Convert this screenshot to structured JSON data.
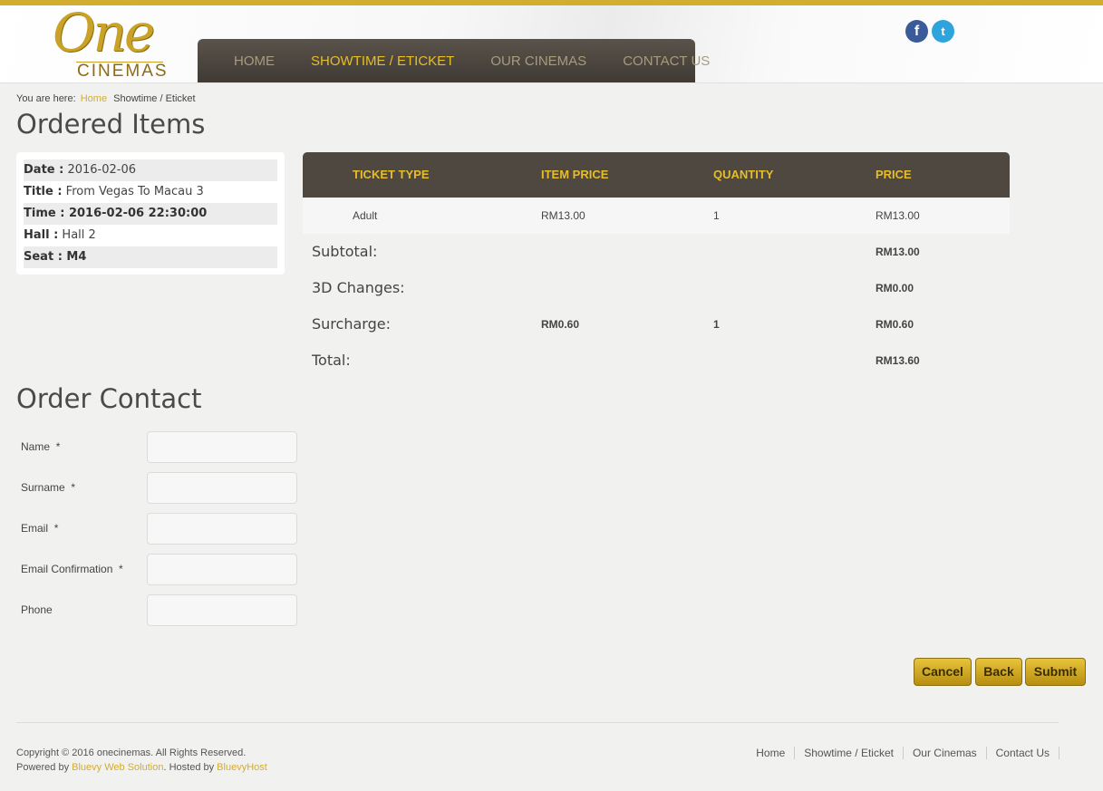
{
  "brand": {
    "logo_main": "One",
    "logo_sub": "CINEMAS",
    "accent": "#d3ad2f"
  },
  "nav": {
    "items": [
      "HOME",
      "SHOWTIME / ETICKET",
      "OUR CINEMAS",
      "CONTACT US"
    ],
    "active": "SHOWTIME / ETICKET"
  },
  "social": {
    "facebook": "f",
    "twitter": "t"
  },
  "breadcrumb": {
    "prefix": "You are here:",
    "home": "Home",
    "current": "Showtime / Eticket"
  },
  "ordered": {
    "title": "Ordered Items",
    "info": [
      {
        "label": "Date :",
        "value": " 2016-02-06",
        "value_bold": false
      },
      {
        "label": "Title :",
        "value": " From Vegas To Macau 3",
        "value_bold": false
      },
      {
        "label": "Time :",
        "value": " 2016-02-06 22:30:00",
        "value_bold": true
      },
      {
        "label": "Hall :",
        "value": " Hall 2",
        "value_bold": false
      },
      {
        "label": "Seat :",
        "value": " M4",
        "value_bold": true
      }
    ],
    "columns": [
      "TICKET TYPE",
      "ITEM PRICE",
      "QUANTITY",
      "PRICE"
    ],
    "rows": [
      {
        "type": "Adult",
        "item_price": "RM13.00",
        "quantity": "1",
        "price": "RM13.00"
      }
    ],
    "subtotal": {
      "label": "Subtotal:",
      "value": "RM13.00"
    },
    "changes_3d": {
      "label": "3D Changes:",
      "value": "RM0.00"
    },
    "surcharge": {
      "label": "Surcharge:",
      "item_price": "RM0.60",
      "quantity": "1",
      "value": "RM0.60"
    },
    "total": {
      "label": "Total:",
      "value": "RM13.60"
    }
  },
  "contact": {
    "title": "Order Contact",
    "fields": [
      {
        "label": "Name",
        "required": "*"
      },
      {
        "label": "Surname",
        "required": "*"
      },
      {
        "label": "Email",
        "required": "*"
      },
      {
        "label": "Email Confirmation",
        "required": "*"
      },
      {
        "label": "Phone",
        "required": ""
      }
    ]
  },
  "buttons": {
    "cancel": "Cancel",
    "back": "Back",
    "submit": "Submit"
  },
  "footer": {
    "copyright": "Copyright © 2016 onecinemas. All Rights Reserved.",
    "powered_prefix": "Powered by ",
    "powered_link": "Bluevy Web Solution",
    "hosted_prefix": ". Hosted by ",
    "hosted_link": "BluevyHost",
    "nav": [
      "Home",
      "Showtime / Eticket",
      "Our Cinemas",
      "Contact Us"
    ]
  }
}
